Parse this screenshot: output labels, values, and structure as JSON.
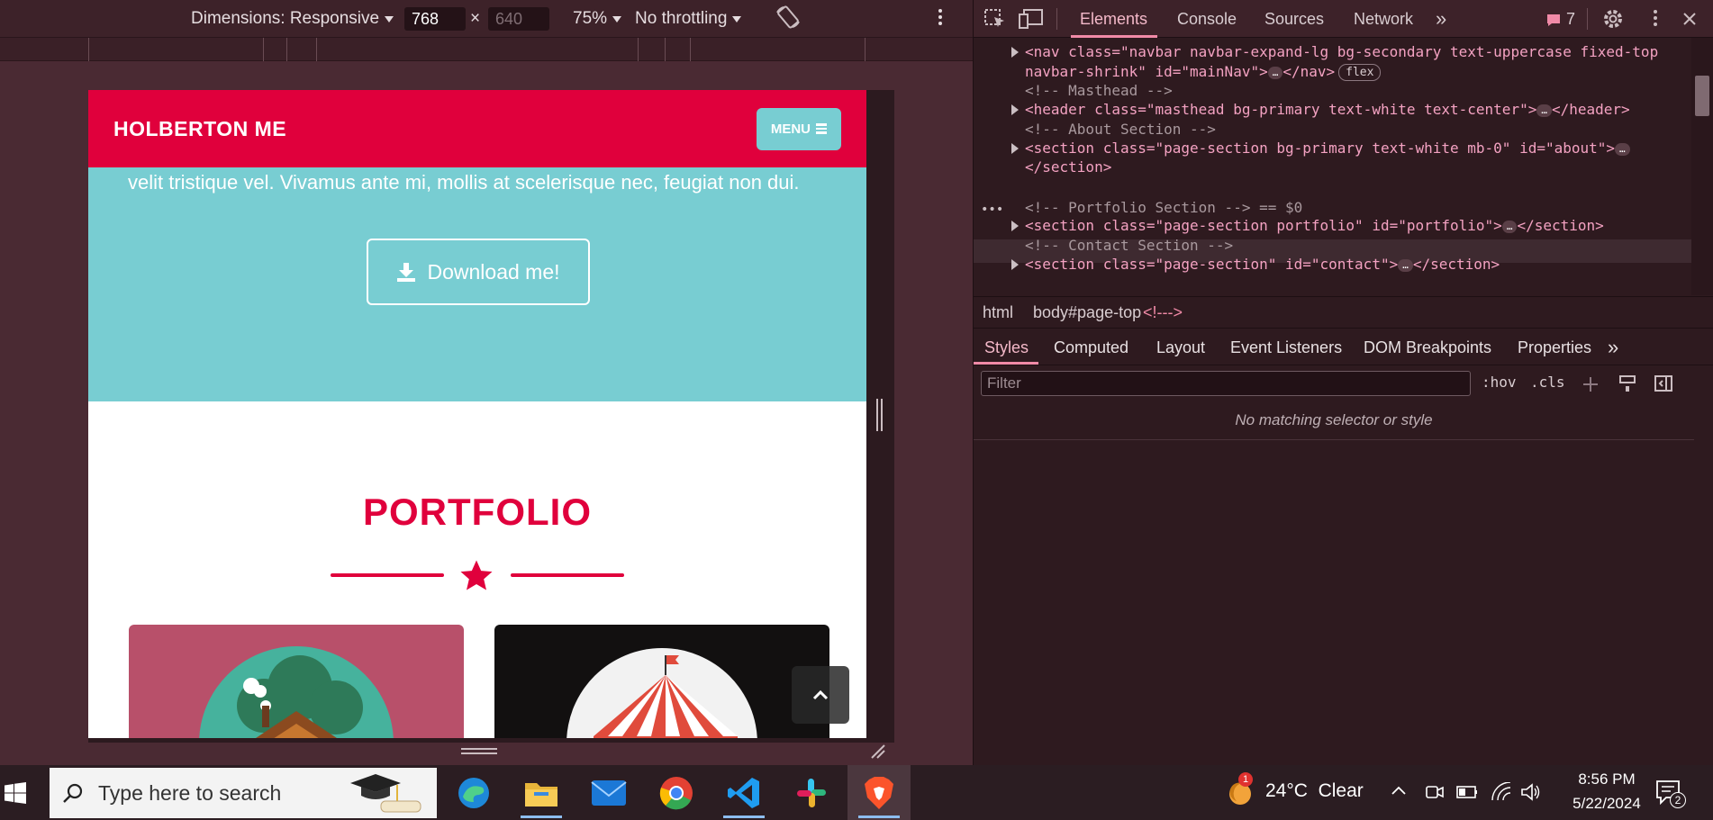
{
  "device_toolbar": {
    "dimensions_label": "Dimensions: Responsive",
    "width_value": "768",
    "separator": "×",
    "height_placeholder": "640",
    "zoom": "75%",
    "throttling": "No throttling"
  },
  "emulated_page": {
    "brand": "HOLBERTON ME",
    "menu_label": "MENU",
    "about_text": "velit tristique vel. Vivamus ante mi, mollis at scelerisque nec, feugiat non dui.",
    "download_label": "Download me!",
    "portfolio_title": "PORTFOLIO",
    "colors": {
      "primary": "#e0003c",
      "secondary": "#78cdd2"
    }
  },
  "devtools": {
    "tabs": [
      "Elements",
      "Console",
      "Sources",
      "Network"
    ],
    "more_tabs": "»",
    "issues_count": "7",
    "dom_lines": {
      "nav_open": "<nav class=\"navbar navbar-expand-lg bg-secondary text-uppercase fixed-top",
      "nav_cont": "navbar-shrink\" id=\"mainNav\">",
      "nav_close": "</nav>",
      "flex_badge": "flex",
      "masthead_comment": "<!-- Masthead -->",
      "header_line": "<header class=\"masthead bg-primary text-white text-center\">",
      "header_close": "</header>",
      "about_comment": "<!-- About Section -->",
      "about_line": "<section class=\"page-section bg-primary text-white mb-0\" id=\"about\">",
      "about_close": "</section>",
      "portfolio_comment": "<!-- Portfolio Section --> == $0",
      "portfolio_line": "<section class=\"page-section portfolio\" id=\"portfolio\">",
      "portfolio_close": "</section>",
      "contact_comment": "<!-- Contact Section -->",
      "contact_line": "<section class=\"page-section\" id=\"contact\">",
      "contact_close": "</section>",
      "ellipsis": "…"
    },
    "breadcrumbs": [
      "html",
      "body#page-top",
      "<!--->"
    ],
    "styles_tabs": [
      "Styles",
      "Computed",
      "Layout",
      "Event Listeners",
      "DOM Breakpoints",
      "Properties"
    ],
    "filter_placeholder": "Filter",
    "hov": ":hov",
    "cls": ".cls",
    "no_match": "No matching selector or style"
  },
  "taskbar": {
    "search_placeholder": "Type here to search",
    "apps": [
      "edge-icon",
      "file-explorer-icon",
      "mail-icon",
      "chrome-icon",
      "vscode-icon",
      "slack-icon",
      "brave-icon"
    ],
    "weather_badge": "1",
    "weather": "24°C  Clear",
    "time": "8:56 PM",
    "date": "5/22/2024",
    "notifications_count": "2"
  }
}
